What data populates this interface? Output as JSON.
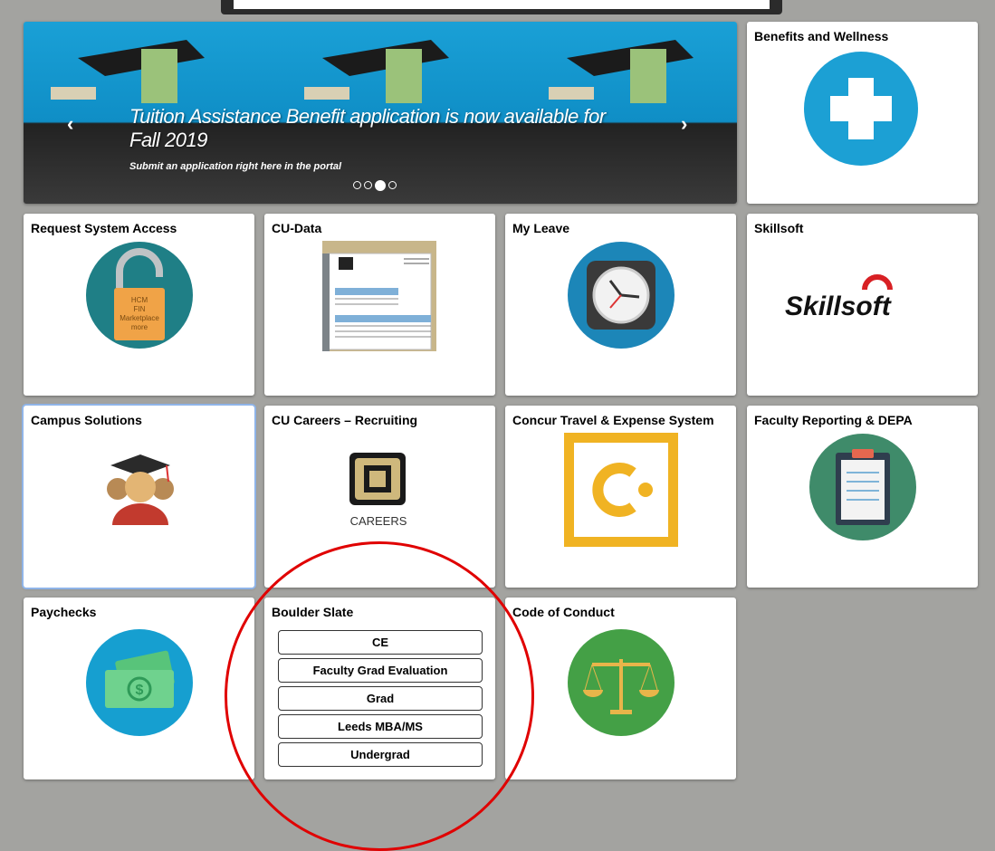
{
  "banner": {
    "title": "Tuition Assistance Benefit application is now available for Fall 2019",
    "subtitle": "Submit an application right here in the portal",
    "active_slide": 3,
    "slide_count": 4
  },
  "tiles": {
    "benefits": {
      "title": "Benefits and Wellness"
    },
    "request_access": {
      "title": "Request System Access",
      "lock_text": [
        "HCM",
        "FIN",
        "Marketplace",
        "more"
      ]
    },
    "cu_data": {
      "title": "CU-Data"
    },
    "my_leave": {
      "title": "My Leave"
    },
    "skillsoft": {
      "title": "Skillsoft",
      "logo_text": "Skillsoft"
    },
    "campus": {
      "title": "Campus Solutions"
    },
    "careers": {
      "title": "CU Careers – Recruiting",
      "logo_text": "CAREERS"
    },
    "concur": {
      "title": "Concur Travel & Expense System"
    },
    "faculty": {
      "title": "Faculty Reporting & DEPA"
    },
    "paychecks": {
      "title": "Paychecks"
    },
    "boulder_slate": {
      "title": "Boulder Slate",
      "buttons": [
        "CE",
        "Faculty Grad Evaluation",
        "Grad",
        "Leeds MBA/MS",
        "Undergrad"
      ]
    },
    "conduct": {
      "title": "Code of Conduct"
    }
  },
  "colors": {
    "background": "#a3a3a0",
    "annotation_circle": "#e00000",
    "benefits_blue": "#1ca0d4",
    "concur_yellow": "#f0b323"
  }
}
